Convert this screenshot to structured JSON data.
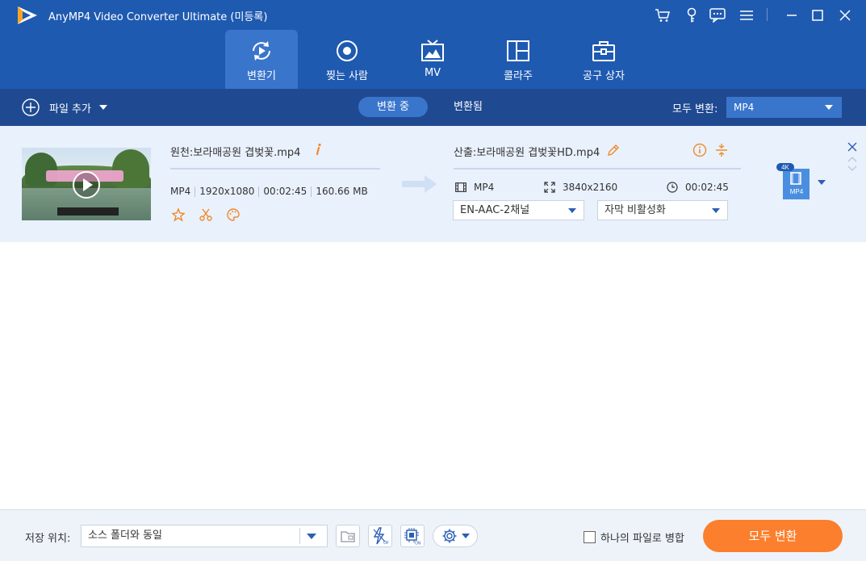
{
  "app": {
    "title": "AnyMP4 Video Converter Ultimate (미등록)"
  },
  "window_controls": {
    "icons": [
      "cart-icon",
      "key-icon",
      "chat-icon",
      "menu-icon",
      "minimize-icon",
      "maximize-icon",
      "close-icon"
    ]
  },
  "tabs": [
    {
      "label": "변환기",
      "icon": "convert-icon",
      "active": true
    },
    {
      "label": "찢는 사람",
      "icon": "ripper-disc-icon",
      "active": false
    },
    {
      "label": "MV",
      "icon": "tv-icon",
      "active": false
    },
    {
      "label": "콜라주",
      "icon": "collage-icon",
      "active": false
    },
    {
      "label": "공구 상자",
      "icon": "toolbox-icon",
      "active": false
    }
  ],
  "toolbar": {
    "add_file": "파일 추가",
    "converting": "변환 중",
    "converted": "변환됨",
    "convert_all_label": "모두 변환:",
    "convert_all_format": "MP4"
  },
  "file": {
    "source_name": "원천:보라매공원 겹벚꽃.mp4",
    "format": "MP4",
    "resolution": "1920x1080",
    "duration": "00:02:45",
    "size": "160.66 MB",
    "output_name": "산출:보라매공원 겹벚꽃HD.mp4",
    "output_format": "MP4",
    "output_resolution": "3840x2160",
    "output_duration": "00:02:45",
    "audio_track": "EN-AAC-2채널",
    "subtitle": "자막 비활성화",
    "badge_quality": "4K",
    "badge_format": "MP4"
  },
  "bottom": {
    "save_label": "저장 위치:",
    "save_value": "소스 폴더와 동일",
    "merge_label": "하나의 파일로 병합",
    "convert_all_button": "모두 변환"
  },
  "colors": {
    "header_bg": "#1f5ab1",
    "toolbar_bg": "#1f4a91",
    "active_tab": "#3a75cc",
    "row_bg": "#e9f1fc",
    "accent_orange": "#fb7f2d",
    "brand_blue": "#2b5fb4"
  }
}
